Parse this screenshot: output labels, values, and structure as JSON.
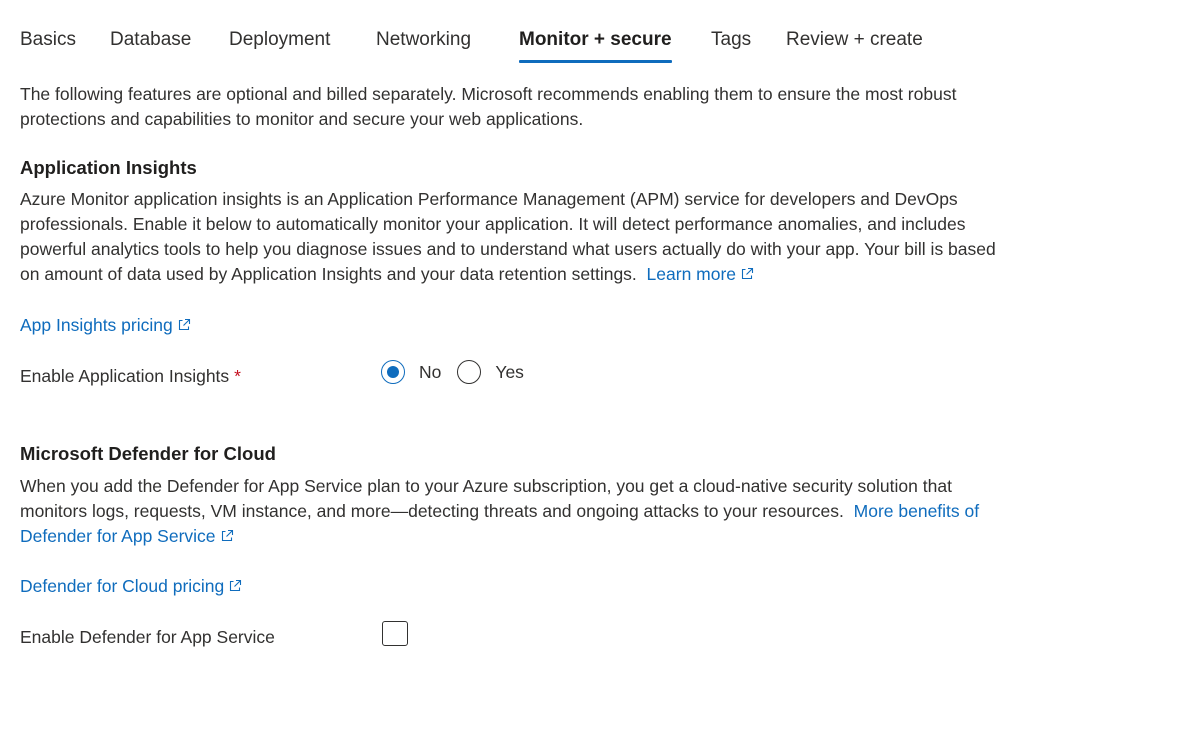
{
  "tabs": [
    {
      "label": "Basics"
    },
    {
      "label": "Database"
    },
    {
      "label": "Deployment"
    },
    {
      "label": "Networking"
    },
    {
      "label": "Monitor + secure",
      "active": true
    },
    {
      "label": "Tags"
    },
    {
      "label": "Review + create"
    }
  ],
  "intro": "The following features are optional and billed separately. Microsoft recommends enabling them to ensure the most robust protections and capabilities to monitor and secure your web applications.",
  "app_insights": {
    "heading": "Application Insights",
    "description": "Azure Monitor application insights is an Application Performance Management (APM) service for developers and DevOps professionals. Enable it below to automatically monitor your application. It will detect performance anomalies, and includes powerful analytics tools to help you diagnose issues and to understand what users actually do with your app. Your bill is based on amount of data used by Application Insights and your data retention settings.",
    "learn_more": "Learn more",
    "pricing_link": "App Insights pricing",
    "enable_label": "Enable Application Insights",
    "required_marker": "*",
    "options": {
      "no": "No",
      "yes": "Yes"
    },
    "selected": "No"
  },
  "defender": {
    "heading": "Microsoft Defender for Cloud",
    "description": "When you add the Defender for App Service plan to your Azure subscription, you get a cloud-native security solution that monitors logs, requests, VM instance, and more—detecting threats and ongoing attacks to your resources.",
    "more_benefits": "More benefits of Defender for App Service",
    "pricing_link": "Defender for Cloud pricing",
    "enable_label": "Enable Defender for App Service",
    "enabled": false
  },
  "colors": {
    "link": "#0f6cbd",
    "active_tab_underline": "#0f6cbd",
    "required": "#c50f1f"
  },
  "icons": {
    "external_link": "open-external-icon"
  }
}
